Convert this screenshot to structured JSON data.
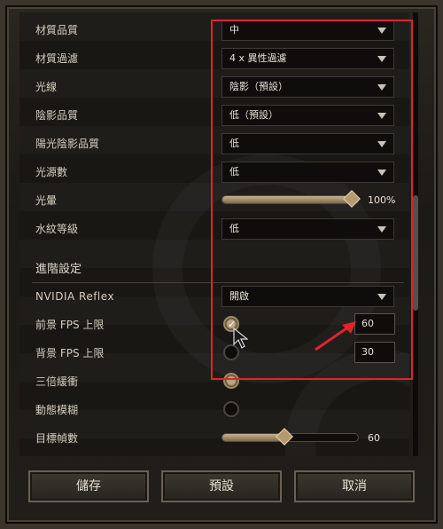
{
  "settings": {
    "texture_quality": {
      "label": "材質品質",
      "value": "中"
    },
    "texture_filtering": {
      "label": "材質過濾",
      "value": "4 x 異性過濾"
    },
    "lighting": {
      "label": "光線",
      "value": "陰影（預設）"
    },
    "shadow_quality": {
      "label": "陰影品質",
      "value": "低（預設）"
    },
    "sun_shadow_quality": {
      "label": "陽光陰影品質",
      "value": "低"
    },
    "light_sources": {
      "label": "光源數",
      "value": "低"
    },
    "bloom": {
      "label": "光暈",
      "value_text": "100%",
      "fraction": 1.0
    },
    "water_level": {
      "label": "水紋等級",
      "value": "低"
    }
  },
  "advanced": {
    "heading": "進階設定",
    "nvidia_reflex": {
      "label": "NVIDIA Reflex",
      "value": "開啟"
    },
    "foreground_fps_cap": {
      "label": "前景 FPS 上限",
      "checked": true,
      "value": "60"
    },
    "background_fps_cap": {
      "label": "背景 FPS 上限",
      "checked": false,
      "value": "30"
    },
    "triple_buffering": {
      "label": "三倍緩衝",
      "checked": true
    },
    "motion_blur": {
      "label": "動態模糊",
      "checked": false
    },
    "target_frame_rate": {
      "label": "目標幀數",
      "value_text": "60",
      "fraction": 0.45
    }
  },
  "buttons": {
    "save": "儲存",
    "default": "預設",
    "cancel": "取消"
  },
  "colors": {
    "annotation_red": "#e0242a",
    "accent_gold": "#b49a70"
  },
  "icons": {
    "cursor": "mouse-pointer-icon",
    "arrow": "annotation-arrow-icon"
  }
}
